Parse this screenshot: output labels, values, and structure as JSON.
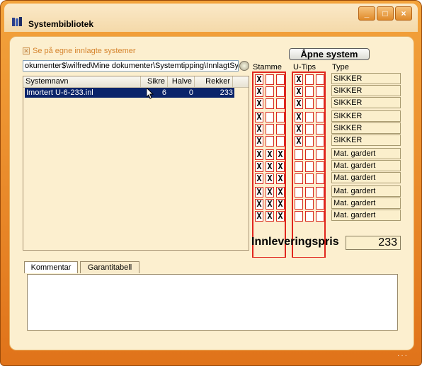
{
  "window": {
    "title": "Systembibliotek",
    "buttons": [
      "_",
      "□",
      "×"
    ]
  },
  "checkbox": {
    "label": "Se på egne innlagte systemer",
    "checked": true
  },
  "path": {
    "value": "okumenter$\\wilfred\\Mine dokumenter\\Systemtipping\\InnlagtSys"
  },
  "systems_list": {
    "columns": [
      "Systemnavn",
      "Sikre",
      "Halve",
      "Rekker"
    ],
    "rows": [
      {
        "name": "Imortert U-6-233.inl",
        "sikre": "6",
        "halve": "0",
        "rekker": "233",
        "selected": true
      }
    ]
  },
  "open_button": {
    "label": "Åpne system"
  },
  "columns": {
    "stamme": "Stamme",
    "utips": "U-Tips",
    "type": "Type"
  },
  "stamme": [
    [
      "X",
      "",
      ""
    ],
    [
      "X",
      "",
      ""
    ],
    [
      "X",
      "",
      ""
    ],
    [
      "X",
      "",
      ""
    ],
    [
      "X",
      "",
      ""
    ],
    [
      "X",
      "",
      ""
    ],
    [
      "X",
      "X",
      "X"
    ],
    [
      "X",
      "X",
      "X"
    ],
    [
      "X",
      "X",
      "X"
    ],
    [
      "X",
      "X",
      "X"
    ],
    [
      "X",
      "X",
      "X"
    ],
    [
      "X",
      "X",
      "X"
    ]
  ],
  "utips": [
    [
      "X",
      "",
      ""
    ],
    [
      "X",
      "",
      ""
    ],
    [
      "X",
      "",
      ""
    ],
    [
      "X",
      "",
      ""
    ],
    [
      "X",
      "",
      ""
    ],
    [
      "X",
      "",
      ""
    ],
    [
      "",
      "",
      ""
    ],
    [
      "",
      "",
      ""
    ],
    [
      "",
      "",
      ""
    ],
    [
      "",
      "",
      ""
    ],
    [
      "",
      "",
      ""
    ],
    [
      "",
      "",
      ""
    ]
  ],
  "types": [
    "SIKKER",
    "SIKKER",
    "SIKKER",
    "SIKKER",
    "SIKKER",
    "SIKKER",
    "Mat. gardert",
    "Mat. gardert",
    "Mat. gardert",
    "Mat. gardert",
    "Mat. gardert",
    "Mat. gardert"
  ],
  "price": {
    "label": "Innleveringspris",
    "value": "233"
  },
  "tabs": [
    {
      "label": "Kommentar",
      "active": true
    },
    {
      "label": "Garantitabell",
      "active": false
    }
  ],
  "colors": {
    "frame": "#e0731a",
    "client": "#fcefcf",
    "grid_red": "#e0261e",
    "selection": "#0a246a"
  }
}
